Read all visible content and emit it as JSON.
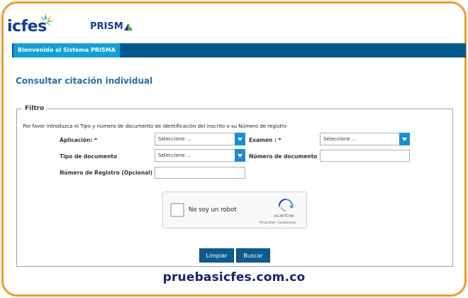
{
  "brand": {
    "icfes_logo_text": "icfes",
    "prisma_logo_text": "PRISM",
    "colors": {
      "navy": "#163f8c",
      "frame": "#f39a2b",
      "nav_bar": "#005a8e",
      "nav_tab": "#12a0d4",
      "button": "#0e5c8f"
    }
  },
  "nav": {
    "welcome_tab": "Bienvenido al Sistema PRISMA"
  },
  "page": {
    "title": "Consultar citación individual"
  },
  "filter": {
    "legend": "Filtro",
    "instructions": "Por favor introduzca el Tipo y número de documento de identificación del inscrito o su Número de registro",
    "aplicacion": {
      "label": "Aplicación: *",
      "selected": "Seleccione ..."
    },
    "examen": {
      "label": "Examen : *",
      "selected": "Seleccione ..."
    },
    "tipo_documento": {
      "label": "Tipo de documento",
      "selected": "Seleccione ..."
    },
    "numero_documento": {
      "label": "Número de documento",
      "value": ""
    },
    "numero_registro": {
      "label": "Número de Registro (Opcional)",
      "value": ""
    }
  },
  "captcha": {
    "label": "No soy un robot",
    "brand": "reCAPTCHA",
    "terms": "Privacidad - Condiciones",
    "checked": false
  },
  "actions": {
    "clear_label": "Limpiar",
    "search_label": "Buscar"
  },
  "footer": {
    "url": "pruebasicfes.com.co"
  }
}
